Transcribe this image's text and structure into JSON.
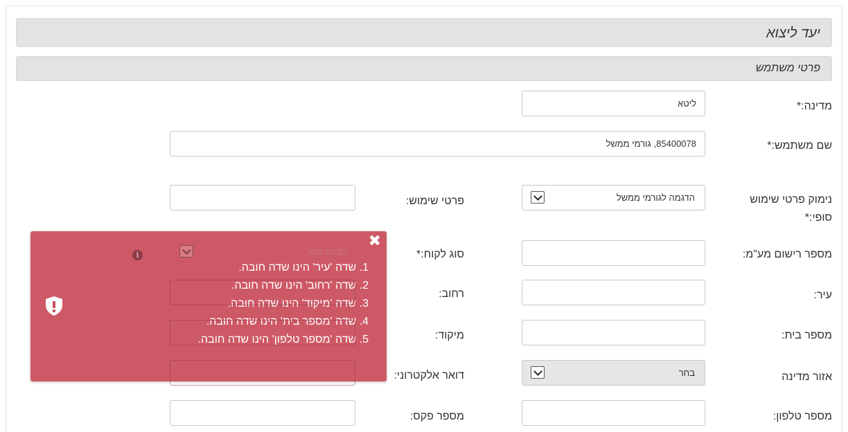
{
  "form": {
    "title": "יעד ליצוא",
    "section_title": "פרטי משתמש"
  },
  "fields": {
    "country_label": "מדינה:*",
    "country_value": "ליטא",
    "username_label": "שם משתמש:*",
    "username_value": "85400078, גורמי ממשל",
    "end_use_reason_label": "נימוק פרטי שימוש סופי:*",
    "end_use_reason_value": "הדגמה לגורמי ממשל",
    "use_details_label": "פרטי שימוש:",
    "use_details_value": "",
    "registration_label": "מספר רישום מע\"מ:",
    "registration_value": "",
    "customer_type_label": "סוג לקוח:*",
    "customer_type_value": "חברת סחר",
    "city_label": "עיר:",
    "city_value": "",
    "street_label": "רחוב:",
    "street_value": "",
    "house_label": "מספר בית:",
    "house_value": "",
    "zip_label": "מיקוד:",
    "zip_value": "",
    "region_label": "אזור מדינה",
    "region_value": "בחר",
    "email_label": "דואר אלקטרוני:",
    "email_value": "",
    "phone_label": "מספר טלפון:",
    "phone_value": "",
    "fax_label": "מספר פקס:",
    "fax_value": ""
  },
  "toast": {
    "close_symbol": "✖",
    "messages": [
      {
        "num": "1.",
        "text": "שדה 'עיר' הינו שדה חובה."
      },
      {
        "num": "2.",
        "text": "שדה 'רחוב' הינו שדה חובה."
      },
      {
        "num": "3.",
        "text": "שדה 'מיקוד' הינו שדה חובה."
      },
      {
        "num": "4.",
        "text": "שדה 'מספר בית' הינו שדה חובה."
      },
      {
        "num": "5.",
        "text": "שדה 'מספר טלפון' הינו שדה חובה."
      }
    ],
    "color": "#ca4c5a"
  },
  "icons": {
    "info": "i",
    "shield": "shield-alert-icon",
    "dropdown": "chevron-down-icon"
  }
}
